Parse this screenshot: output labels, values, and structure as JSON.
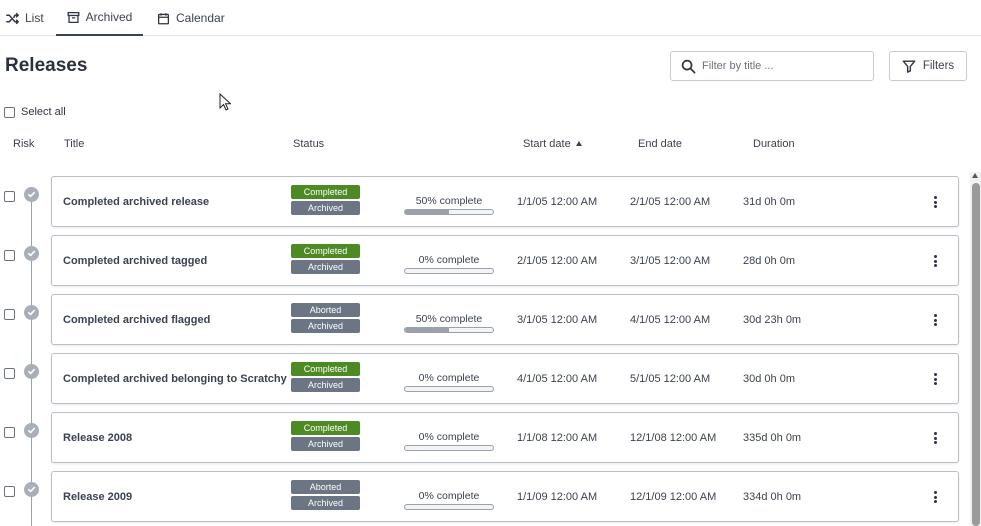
{
  "tabs": [
    {
      "label": "List",
      "icon": "shuffle-icon"
    },
    {
      "label": "Archived",
      "icon": "archive-box-icon"
    },
    {
      "label": "Calendar",
      "icon": "calendar-icon"
    }
  ],
  "page_title": "Releases",
  "search": {
    "placeholder": "Filter by title ..."
  },
  "filters_label": "Filters",
  "select_all_label": "Select all",
  "columns": {
    "risk": "Risk",
    "title": "Title",
    "status": "Status",
    "start_date": "Start date",
    "end_date": "End date",
    "duration": "Duration"
  },
  "colors": {
    "completed": "#4e8a24",
    "aborted": "#6c7584",
    "archived": "#6c7584",
    "risk_icon": "#a9afb8",
    "progress": "#9aa1ab"
  },
  "releases": [
    {
      "title": "Completed archived release",
      "status": "Completed",
      "status2": "Archived",
      "progress_label": "50% complete",
      "progress": 0.5,
      "start": "1/1/05 12:00 AM",
      "end": "2/1/05 12:00 AM",
      "duration": "31d 0h 0m"
    },
    {
      "title": "Completed archived tagged",
      "status": "Completed",
      "status2": "Archived",
      "progress_label": "0% complete",
      "progress": 0,
      "start": "2/1/05 12:00 AM",
      "end": "3/1/05 12:00 AM",
      "duration": "28d 0h 0m"
    },
    {
      "title": "Completed archived flagged",
      "status": "Aborted",
      "status2": "Archived",
      "progress_label": "50% complete",
      "progress": 0.5,
      "start": "3/1/05 12:00 AM",
      "end": "4/1/05 12:00 AM",
      "duration": "30d 23h 0m"
    },
    {
      "title": "Completed archived belonging to Scratchy",
      "status": "Completed",
      "status2": "Archived",
      "progress_label": "0% complete",
      "progress": 0,
      "start": "4/1/05 12:00 AM",
      "end": "5/1/05 12:00 AM",
      "duration": "30d 0h 0m"
    },
    {
      "title": "Release 2008",
      "status": "Completed",
      "status2": "Archived",
      "progress_label": "0% complete",
      "progress": 0,
      "start": "1/1/08 12:00 AM",
      "end": "12/1/08 12:00 AM",
      "duration": "335d 0h 0m"
    },
    {
      "title": "Release 2009",
      "status": "Aborted",
      "status2": "Archived",
      "progress_label": "0% complete",
      "progress": 0,
      "start": "1/1/09 12:00 AM",
      "end": "12/1/09 12:00 AM",
      "duration": "334d 0h 0m"
    }
  ]
}
